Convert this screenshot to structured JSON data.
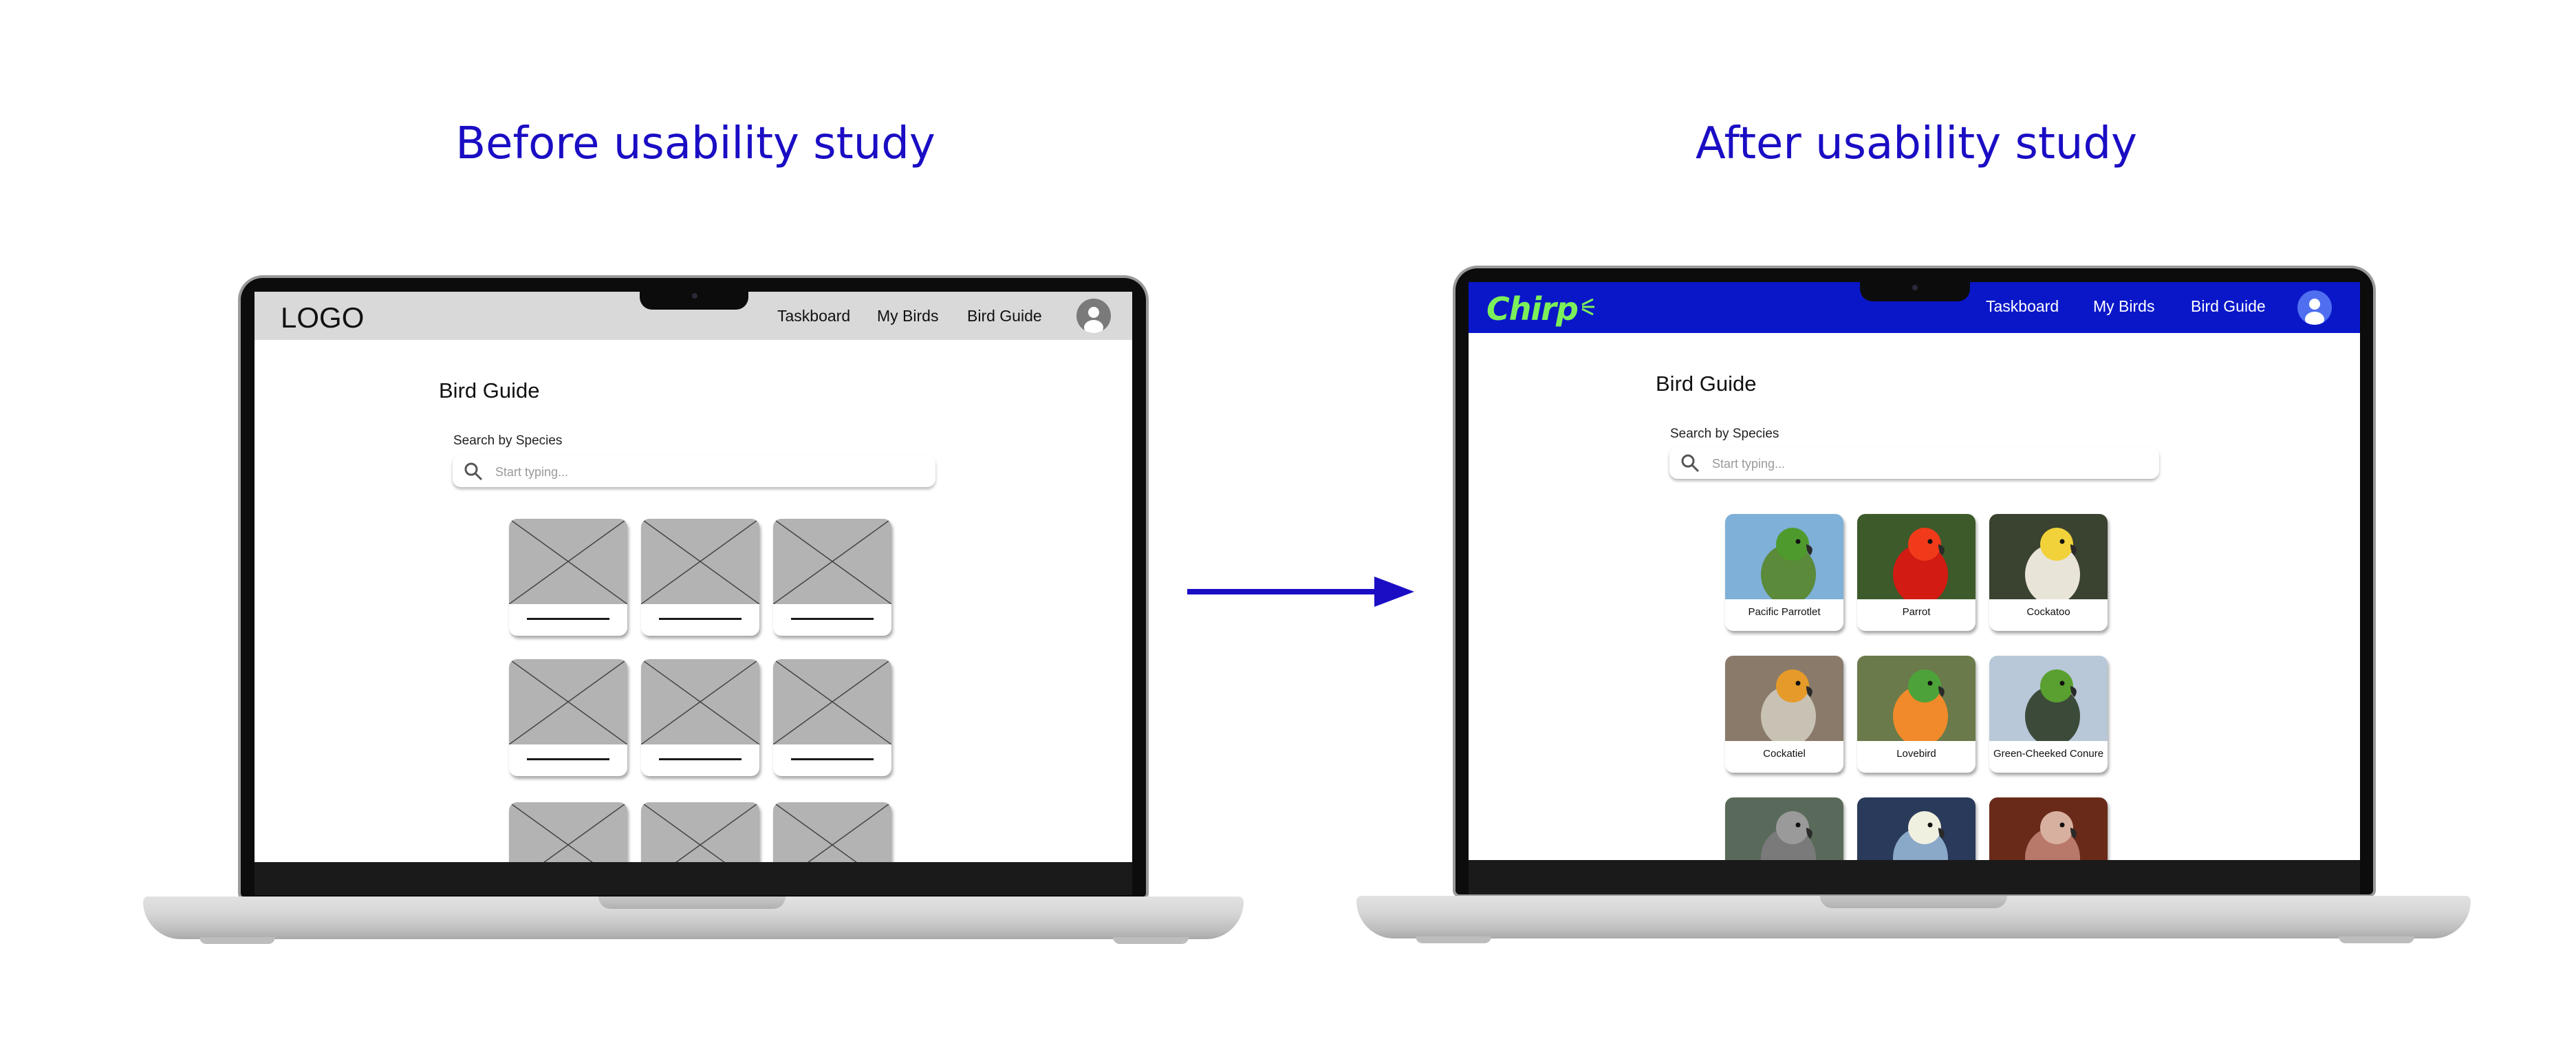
{
  "headings": {
    "before": "Before usability study",
    "after": "After usability study"
  },
  "before": {
    "logo": "LOGO",
    "nav": [
      "Taskboard",
      "My Birds",
      "Bird Guide"
    ],
    "page_title": "Bird Guide",
    "search_label": "Search by Species",
    "search_placeholder": "Start typing...",
    "colors": {
      "navbar": "#d9d9d9",
      "placeholder_image": "#b3b3b3"
    }
  },
  "after": {
    "logo": "Chirp",
    "nav": [
      "Taskboard",
      "My Birds",
      "Bird Guide"
    ],
    "page_title": "Bird Guide",
    "search_label": "Search by Species",
    "search_placeholder": "Start typing...",
    "birds": [
      {
        "name": "Pacific Parrotlet",
        "colors": [
          "#7fb0d8",
          "#5a8a3a",
          "#4f9a2c"
        ]
      },
      {
        "name": "Parrot",
        "colors": [
          "#3c5a2a",
          "#d21b12",
          "#f03a1a"
        ]
      },
      {
        "name": "Cockatoo",
        "colors": [
          "#3a4230",
          "#e8e4d8",
          "#f1d23a"
        ]
      },
      {
        "name": "Cockatiel",
        "colors": [
          "#8a7a6a",
          "#c8c2b4",
          "#e59a2a"
        ]
      },
      {
        "name": "Lovebird",
        "colors": [
          "#6a7a4a",
          "#f08a2a",
          "#4ea23a"
        ]
      },
      {
        "name": "Green-Cheeked Conure",
        "colors": [
          "#b8c8d8",
          "#3c4a3a",
          "#5aa030"
        ]
      },
      {
        "name": "",
        "colors": [
          "#5a6a5a",
          "#7a7a7a",
          "#9a9a9a"
        ]
      },
      {
        "name": "",
        "colors": [
          "#2a3a5a",
          "#8aa8c8",
          "#f0f0e0"
        ]
      },
      {
        "name": "",
        "colors": [
          "#6a2a1a",
          "#b8786a",
          "#d8b0a0"
        ]
      }
    ],
    "colors": {
      "navbar": "#0a17c9",
      "logo": "#7cf05a",
      "nav_text": "#ffffff"
    }
  },
  "arrow_color": "#1a0dc4"
}
